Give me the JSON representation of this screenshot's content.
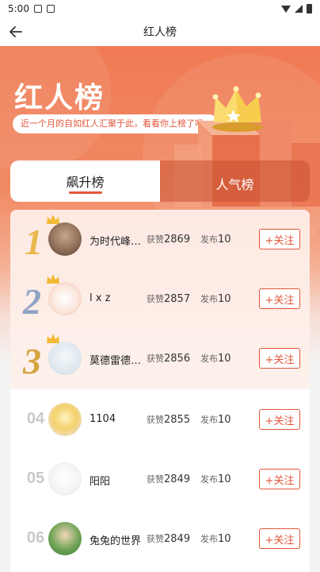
{
  "status_bar": {
    "time": "5:00"
  },
  "nav": {
    "title": "红人榜"
  },
  "hero": {
    "title": "红人榜",
    "subtitle": "近一个月的自如红人汇聚于此，看看你上榜了吗~"
  },
  "tabs": [
    {
      "label": "飙升榜",
      "active": true
    },
    {
      "label": "人气榜",
      "active": false
    }
  ],
  "labels": {
    "likes": "获赞",
    "posts": "发布",
    "follow": "+关注"
  },
  "list": [
    {
      "rank": "1",
      "name": "为时代峰…",
      "likes": "2869",
      "posts": "10"
    },
    {
      "rank": "2",
      "name": "l x z",
      "likes": "2857",
      "posts": "10"
    },
    {
      "rank": "3",
      "name": "莫德雷德…",
      "likes": "2856",
      "posts": "10"
    },
    {
      "rank": "04",
      "name": "1104",
      "likes": "2855",
      "posts": "10"
    },
    {
      "rank": "05",
      "name": "阳阳",
      "likes": "2849",
      "posts": "10"
    },
    {
      "rank": "06",
      "name": "兔兔的世界",
      "likes": "2849",
      "posts": "10"
    }
  ],
  "colors": {
    "accent": "#e2563b",
    "gold": "#e8b84a",
    "silver": "#8fa3c7",
    "bronze": "#d4a640"
  }
}
